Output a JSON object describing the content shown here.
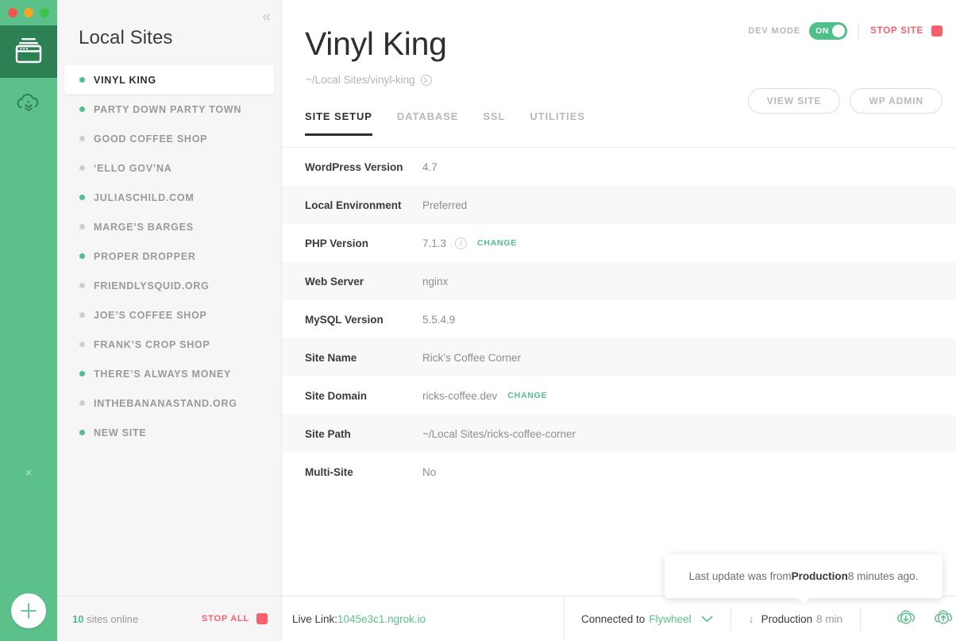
{
  "window": {
    "traffic_lights": [
      "close",
      "minimize",
      "zoom"
    ]
  },
  "rail": {
    "sites_icon": "sites-window-icon",
    "cloud_icon": "cloud-pull-icon",
    "close_label": "×",
    "add_label": "+"
  },
  "sidebar": {
    "title": "Local Sites",
    "collapse_label": "«",
    "items": [
      {
        "label": "VINYL KING",
        "online": true,
        "selected": true
      },
      {
        "label": "PARTY DOWN PARTY TOWN",
        "online": true,
        "selected": false
      },
      {
        "label": "GOOD COFFEE SHOP",
        "online": false,
        "selected": false
      },
      {
        "label": "‘ELLO GOV’NA",
        "online": false,
        "selected": false
      },
      {
        "label": "JULIASCHILD.COM",
        "online": true,
        "selected": false
      },
      {
        "label": "MARGE’S BARGES",
        "online": false,
        "selected": false
      },
      {
        "label": "PROPER DROPPER",
        "online": true,
        "selected": false
      },
      {
        "label": "FRIENDLYSQUID.ORG",
        "online": false,
        "selected": false
      },
      {
        "label": "JOE’S COFFEE SHOP",
        "online": false,
        "selected": false
      },
      {
        "label": "FRANK’S CROP SHOP",
        "online": false,
        "selected": false
      },
      {
        "label": "THERE’S ALWAYS MONEY",
        "online": true,
        "selected": false
      },
      {
        "label": "INTHEBANANASTAND.ORG",
        "online": false,
        "selected": false
      },
      {
        "label": "NEW SITE",
        "online": true,
        "selected": false
      }
    ],
    "footer": {
      "count": "10",
      "count_suffix": " sites online",
      "stop_all": "STOP ALL"
    }
  },
  "header": {
    "dev_mode_label": "DEV MODE",
    "dev_mode_state": "ON",
    "stop_site": "STOP SITE",
    "site_title": "Vinyl King",
    "site_path": "~/Local Sites/vinyl-king",
    "path_arrow": "❯"
  },
  "tabs": [
    {
      "label": "SITE SETUP",
      "active": true
    },
    {
      "label": "DATABASE",
      "active": false
    },
    {
      "label": "SSL",
      "active": false
    },
    {
      "label": "UTILITIES",
      "active": false
    }
  ],
  "header_buttons": [
    {
      "label": "VIEW SITE"
    },
    {
      "label": "WP ADMIN"
    }
  ],
  "details": [
    {
      "label": "WordPress Version",
      "value": "4.7",
      "info": false,
      "change": null
    },
    {
      "label": "Local Environment",
      "value": "Preferred",
      "info": false,
      "change": null
    },
    {
      "label": "PHP Version",
      "value": "7.1.3",
      "info": true,
      "change": "CHANGE"
    },
    {
      "label": "Web Server",
      "value": "nginx",
      "info": false,
      "change": null
    },
    {
      "label": "MySQL Version",
      "value": "5.5.4.9",
      "info": false,
      "change": null
    },
    {
      "label": "Site Name",
      "value": "Rick’s Coffee Corner",
      "info": false,
      "change": null
    },
    {
      "label": "Site Domain",
      "value": "ricks-coffee.dev",
      "info": false,
      "change": "CHANGE"
    },
    {
      "label": "Site Path",
      "value": "~/Local Sites/ricks-coffee-corner",
      "info": false,
      "change": null
    },
    {
      "label": "Multi-Site",
      "value": "No",
      "info": false,
      "change": null
    }
  ],
  "tooltip": {
    "prefix": "Last update was from ",
    "strong": "Production",
    "suffix": " 8 minutes ago."
  },
  "bottombar": {
    "live_link_label": "Live Link: ",
    "live_link_value": "1045e3c1.ngrok.io",
    "connected_label": "Connected to",
    "connected_value": "Flywheel",
    "caret": "⌄",
    "push_arrow": "↓",
    "env_label": "Production",
    "env_time": "8 min",
    "pull_icon": "cloud-download-icon",
    "push_icon": "cloud-upload-icon"
  },
  "colors": {
    "green": "#4fc08a",
    "rail_green": "#5cc08a",
    "rail_active": "#2c8053",
    "red": "#fa5f6e",
    "text_dark": "#2e2e2e",
    "text_muted": "#9a9a9a"
  }
}
